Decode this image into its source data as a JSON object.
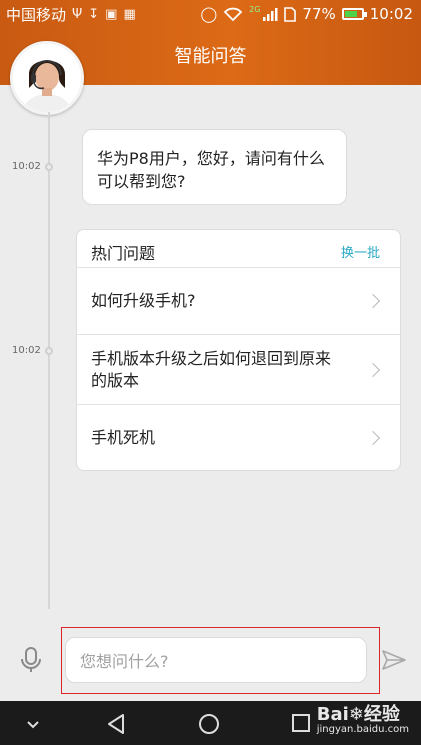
{
  "status_bar": {
    "carrier": "中国移动",
    "network_label": "2G",
    "battery_percent": "77%",
    "time": "10:02",
    "battery_level": 0.77
  },
  "header": {
    "title": "智能问答",
    "accent_color": "#d8641a"
  },
  "chat": {
    "messages": [
      {
        "time": "10:02",
        "text_line1": "华为P8用户，您好，请问有什么",
        "text_line2": "可以帮到您?"
      }
    ],
    "hot_questions": {
      "time": "10:02",
      "title": "热门问题",
      "refresh_label": "换一批",
      "items": [
        {
          "line1": "如何升级手机?",
          "line2": ""
        },
        {
          "line1": "手机版本升级之后如何退回到原来",
          "line2": "的版本"
        },
        {
          "line1": "手机死机",
          "line2": ""
        }
      ]
    }
  },
  "composer": {
    "placeholder": "您想问什么?",
    "value": ""
  },
  "watermark": {
    "brand": "Bai",
    "brand_suffix": "经验",
    "url": "jingyan.baidu.com"
  }
}
